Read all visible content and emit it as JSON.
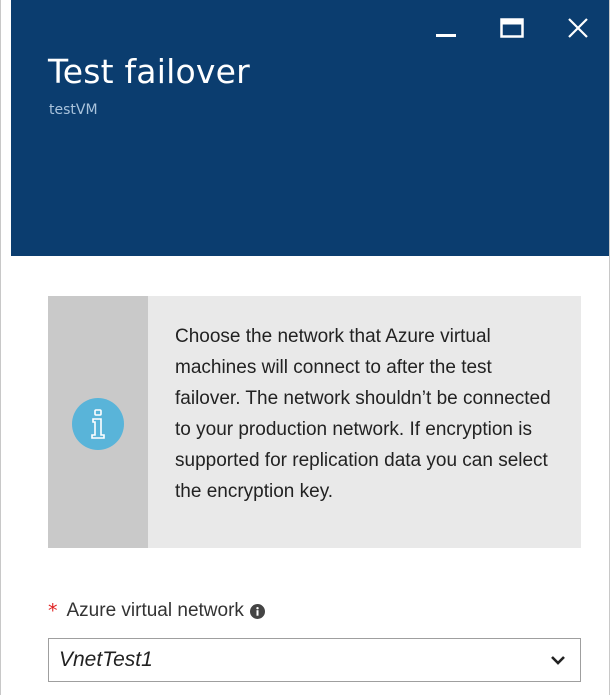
{
  "header": {
    "title": "Test failover",
    "subtitle": "testVM",
    "background": "#0b3d6f",
    "controls": [
      "minimize-icon",
      "maximize-icon",
      "close-icon"
    ]
  },
  "info": {
    "icon": "info-icon",
    "icon_color": "#59b4d9",
    "text": "Choose the network that Azure virtual machines will connect to after the test failover. The network shouldn’t be connected to your production network. If encryption is supported for replication data you can select the encryption key."
  },
  "network_field": {
    "required_marker": "*",
    "label": "Azure virtual network",
    "help_icon": "info-small-icon",
    "selected_value": "VnetTest1",
    "dropdown_icon": "chevron-down-icon"
  }
}
